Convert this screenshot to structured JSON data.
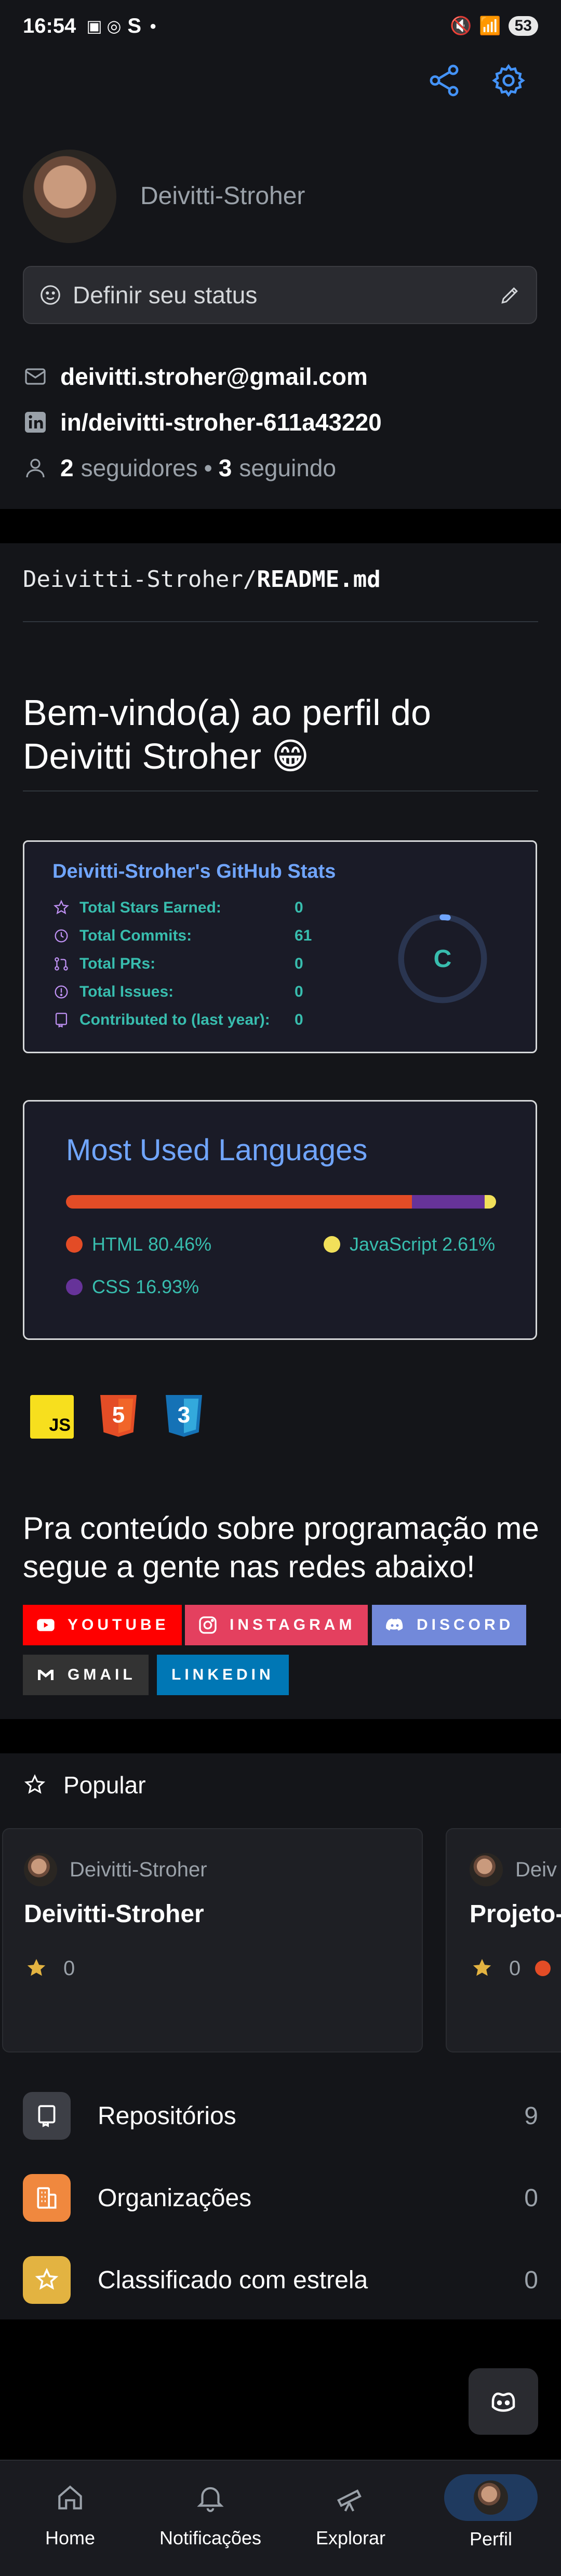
{
  "status_bar": {
    "time": "16:54",
    "extra": "S",
    "battery": "53"
  },
  "profile": {
    "username": "Deivitti-Stroher",
    "status_placeholder": "Definir seu status",
    "email": "deivitti.stroher@gmail.com",
    "linkedin": "in/deivitti-stroher-611a43220",
    "followers_count": "2",
    "followers_label": "seguidores",
    "following_count": "3",
    "following_label": "seguindo"
  },
  "readme": {
    "owner": "Deivitti-Stroher/",
    "file": "README.md",
    "welcome": "Bem-vindo(a) ao perfil do Deivitti Stroher 😁",
    "follow_heading": "Pra conteúdo sobre programação me segue a gente nas redes abaixo!"
  },
  "github_stats": {
    "title": "Deivitti-Stroher's GitHub Stats",
    "rows": [
      {
        "label": "Total Stars Earned:",
        "value": "0"
      },
      {
        "label": "Total Commits:",
        "value": "61"
      },
      {
        "label": "Total PRs:",
        "value": "0"
      },
      {
        "label": "Total Issues:",
        "value": "0"
      },
      {
        "label": "Contributed to (last year):",
        "value": "0"
      }
    ],
    "rank": "C",
    "rank_progress": 0.02
  },
  "languages": {
    "title": "Most Used Languages",
    "items": [
      {
        "name": "HTML",
        "percent_label": "80.46%",
        "percent": 80.46,
        "color": "#e34c26"
      },
      {
        "name": "CSS",
        "percent_label": "16.93%",
        "percent": 16.93,
        "color": "#663399"
      },
      {
        "name": "JavaScript",
        "percent_label": "2.61%",
        "percent": 2.61,
        "color": "#f1e05a"
      }
    ]
  },
  "tech_icons": {
    "js": "JS",
    "html": "5",
    "css": "3"
  },
  "badges": {
    "youtube": "YOUTUBE",
    "instagram": "INSTAGRAM",
    "discord": "DISCORD",
    "gmail": "GMAIL",
    "linkedin": "LINKEDIN"
  },
  "popular": {
    "heading": "Popular",
    "cards": [
      {
        "owner": "Deivitti-Stroher",
        "name": "Deivitti-Stroher",
        "stars": "0"
      },
      {
        "owner": "Deiv",
        "name": "Projeto-",
        "stars": "0"
      }
    ]
  },
  "menu": [
    {
      "label": "Repositórios",
      "count": "9"
    },
    {
      "label": "Organizações",
      "count": "0"
    },
    {
      "label": "Classificado com estrela",
      "count": "0"
    }
  ],
  "nav": {
    "home": "Home",
    "notifications": "Notificações",
    "explore": "Explorar",
    "profile": "Perfil"
  }
}
